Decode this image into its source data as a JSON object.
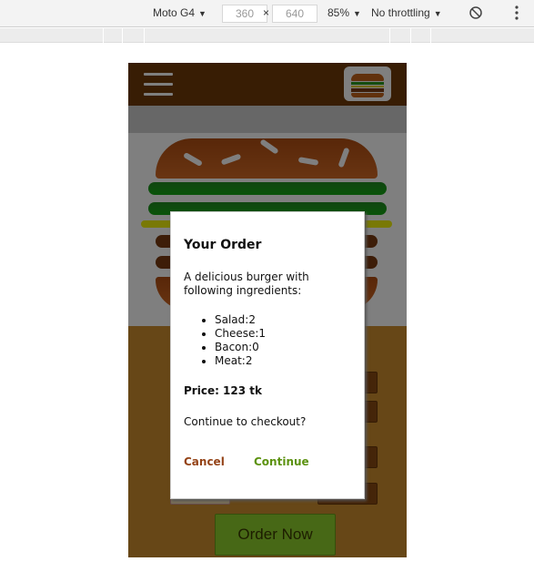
{
  "devtools": {
    "device": "Moto G4",
    "width": "360",
    "height": "640",
    "dimension_separator": "×",
    "zoom": "85%",
    "throttling": "No throttling",
    "menu_icon": "kebab-menu-icon",
    "rotate_icon": "rotate-icon"
  },
  "app": {
    "menu_icon": "hamburger-menu-icon",
    "logo_icon": "burger-logo-icon",
    "order_button": "Order Now"
  },
  "modal": {
    "title": "Your Order",
    "intro": "A delicious burger with following ingredients:",
    "ingredients": [
      {
        "text": "Salad:2"
      },
      {
        "text": "Cheese:1"
      },
      {
        "text": "Bacon:0"
      },
      {
        "text": "Meat:2"
      }
    ],
    "price": "Price: 123 tk",
    "question": "Continue to checkout?",
    "cancel": "Cancel",
    "continue": "Continue"
  },
  "colors": {
    "toolbar": "#703b09",
    "controls_bg": "#cf8f2e",
    "cancel": "#944317",
    "continue": "#5c9210",
    "order_button": "#8fd12d"
  }
}
